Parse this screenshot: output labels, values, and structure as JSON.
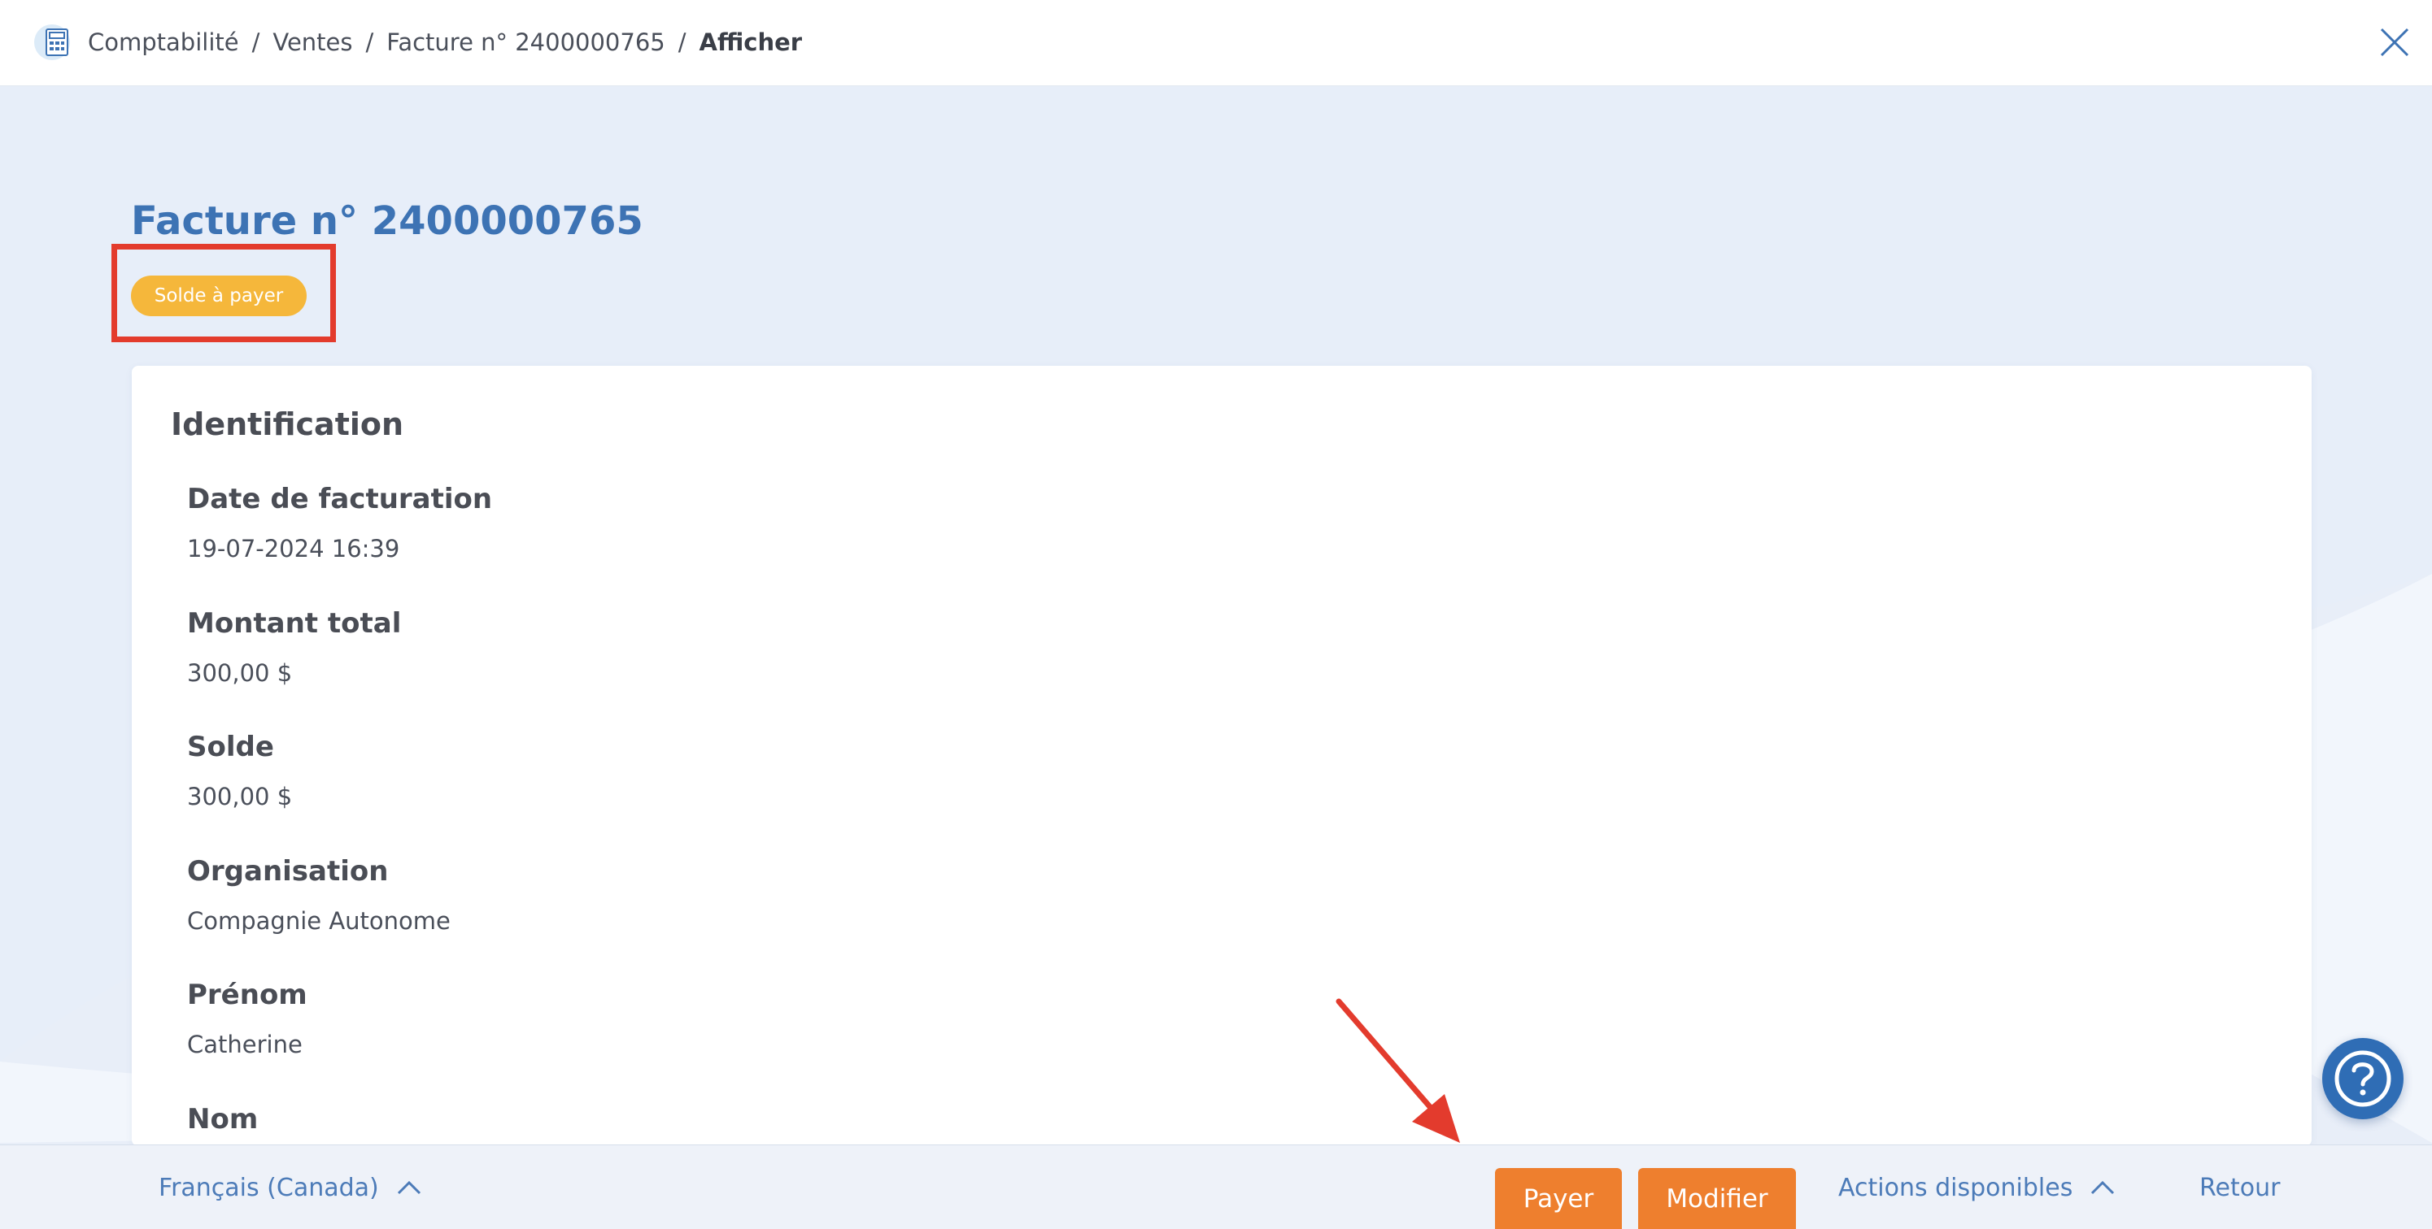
{
  "breadcrumb": {
    "items": [
      "Comptabilité",
      "Ventes",
      "Facture n° 2400000765",
      "Afficher"
    ],
    "separator": "/"
  },
  "page": {
    "title": "Facture n° 2400000765",
    "status": "Solde à payer",
    "status_color": "#f5b73b",
    "accent_color": "#3d73b4"
  },
  "card": {
    "heading": "Identification",
    "fields": [
      {
        "label": "Date de facturation",
        "value": "19-07-2024 16:39"
      },
      {
        "label": "Montant total",
        "value": "300,00 $"
      },
      {
        "label": "Solde",
        "value": "300,00 $"
      },
      {
        "label": "Organisation",
        "value": "Compagnie Autonome"
      },
      {
        "label": "Prénom",
        "value": "Catherine"
      },
      {
        "label": "Nom",
        "value": ""
      }
    ]
  },
  "footer": {
    "language": "Français (Canada)",
    "pay_label": "Payer",
    "edit_label": "Modifier",
    "actions_label": "Actions disponibles",
    "back_label": "Retour",
    "button_color": "#ee7f2e"
  },
  "icons": {
    "app": "calculator-icon",
    "close": "close-icon",
    "help": "help-icon",
    "chevron": "chevron-up-icon"
  },
  "annotations": {
    "highlight_color": "#e33b2d"
  }
}
